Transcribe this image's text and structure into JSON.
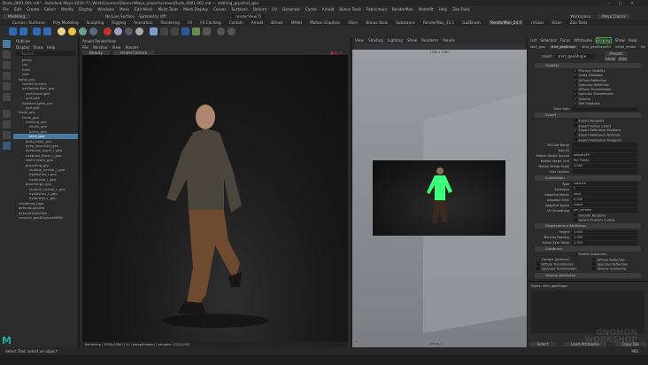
{
  "window": {
    "title": "Dude_0001.001.mb* - Autodesk Maya 2020: F:\\_Work\\Gnomon\\Dancer\\Maya_project\\scenes\\Dude_0001.001.mb  ---  clothing_grp|shirt_geo",
    "workspace_label": "Workspace :",
    "workspace": "Maya Classic"
  },
  "menu": [
    "File",
    "Edit",
    "Create",
    "Select",
    "Modify",
    "Display",
    "Windows",
    "Mesh",
    "Edit Mesh",
    "Mesh Tools",
    "Mesh Display",
    "Curves",
    "Surfaces",
    "Deform",
    "UV",
    "Generate",
    "Cache",
    "Arnold",
    "Bonus Tools",
    "Fabricmani",
    "RenderMan",
    "Redshift",
    "Help",
    "Zoo Tools"
  ],
  "status": {
    "mode": "Modeling",
    "no_live": "No Live Surface",
    "symmetry": "Symmetry: Off",
    "camera": "renderView75"
  },
  "shelf_tabs": [
    "Curves / Surfaces",
    "Poly Modeling",
    "Sculpting",
    "Rigging",
    "Animation",
    "Rendering",
    "FX",
    "FX Caching",
    "Custom",
    "Arnold",
    "Bifrost",
    "MASH",
    "Motion Graphics",
    "XGen",
    "Bonus Tools",
    "Substance",
    "RenderMan_22.1",
    "GoZBrush",
    "RenderMan_24.0",
    "mGear",
    "XGen",
    "Zoo Tools"
  ],
  "shelf_active": "RenderMan_24.0",
  "outliner": {
    "title": "Outliner",
    "menu": [
      "Display",
      "Show",
      "Help"
    ],
    "search": "Search...",
    "items": [
      "persp",
      "top",
      "front",
      "side",
      "lights_grp",
      "renderCamera",
      "pxrRenderMan_grp",
      "pxrDomeLight",
      "pxrLight",
      "lookdevLights_grp",
      "pxrLight",
      "Dude_grp",
      "Dude_geo",
      "clothing_grp",
      "shoes_geo",
      "pants_geo",
      "shirt_geo",
      "body_body_geo",
      "eyes_lowerEye_geo",
      "eyebrow_upper_l_geo",
      "eyebrow_lower_l_geo",
      "teeth_teeth_geo",
      "grooming_grp",
      "stubble_neckal_l_geo",
      "eyelashes_l_geo",
      "eyebrows_l_geo",
      "grooming2_grp",
      "stubble_neckal_r_geo",
      "eyelashes_r_geo",
      "eyebrows_r_geo",
      "rendering_tags",
      "defaultLightSet",
      "defaultObjectSet",
      "rmanvtl_geoDisplaceNMW"
    ],
    "selected": "shirt_geo"
  },
  "render_view": {
    "title": "Arnold RenderView",
    "menu": [
      "File",
      "Window",
      "View",
      "Render"
    ],
    "mode": "Beauty",
    "camera": "renderCamera",
    "footer": "Rendering | 1920x1080 (1.0) | persp(Imager) | samples: 4/2/2/2/4/2"
  },
  "viewport": {
    "menu": [
      "View",
      "Shading",
      "Lighting",
      "Show",
      "Renderer",
      "Panels"
    ],
    "resolution": "1920 x 1080",
    "camera": "persp_1"
  },
  "attr": {
    "menu": [
      "List",
      "Selected",
      "Focus",
      "Attributes",
      "Display",
      "Show",
      "Help"
    ],
    "tabs": [
      "shirt_geo",
      "shirt_geoShape",
      "shirt_geoShapeSG",
      "initial_render",
      "Ilm"
    ],
    "label": "mesh:",
    "value": "shirt_geoShape",
    "focus": "Focus",
    "presets": "Presets",
    "show": "Show",
    "hide": "Hide",
    "visibility": {
      "title": "Visibility",
      "items": [
        "Primary Visibility",
        "Casts Shadows",
        "Diffuse Reflection",
        "Specular Reflection",
        "Diffuse Transmission",
        "Specular Transmission",
        "Volume",
        "Self Shadows"
      ],
      "trace_sets": "Trace Sets"
    },
    "export": {
      "title": "Export",
      "items": [
        {
          "label": "Export Tangents",
          "on": false
        },
        {
          "label": "Export Vertex Colors",
          "on": false
        },
        {
          "label": "Export Reference Positions",
          "on": true
        },
        {
          "label": "Export Reference Normals",
          "on": false
        },
        {
          "label": "Export Reference Tangents",
          "on": false
        }
      ],
      "fields": [
        {
          "label": "SSS Set Name",
          "value": ""
        },
        {
          "label": "Toon ID",
          "value": ""
        },
        {
          "label": "Motion Vector Source",
          "value": "velocityPV"
        },
        {
          "label": "Motion Vector Unit",
          "value": "Per Frame"
        },
        {
          "label": "Motion Vector Scale",
          "value": "1.000"
        },
        {
          "label": "User Options",
          "value": ""
        }
      ]
    },
    "subdivision": {
      "title": "Subdivision",
      "fields": [
        {
          "label": "Type",
          "value": "catclark"
        },
        {
          "label": "Iterations",
          "value": "2"
        },
        {
          "label": "Adaptive Metric",
          "value": "auto"
        },
        {
          "label": "Adaptive Error",
          "value": "0.000"
        },
        {
          "label": "Adaptive Space",
          "value": "raster"
        },
        {
          "label": "UV Smoothing",
          "value": "pin_corners"
        }
      ],
      "checks": [
        "Smooth Tangents",
        "Ignore Frustum Culling"
      ]
    },
    "displacement": {
      "title": "Displacement Attributes",
      "fields": [
        {
          "label": "Height",
          "value": "1.000"
        },
        {
          "label": "Bounds Padding",
          "value": "1.000"
        },
        {
          "label": "Scalar Zero Value",
          "value": "1.000"
        }
      ]
    },
    "autobump": {
      "title": "Autobump",
      "enable": "Enable Autobump",
      "items": [
        {
          "label": "Camera (primary)",
          "on": true
        },
        {
          "label": "Diffuse Reflection",
          "on": false
        },
        {
          "label": "Diffuse Transmission",
          "on": false
        },
        {
          "label": "Specular Reflection",
          "on": false
        },
        {
          "label": "Specular Transmission",
          "on": false
        },
        {
          "label": "Volume Scattering",
          "on": false
        }
      ]
    },
    "next_section": "Volume Attributes",
    "notes": "Notes:  shirt_geoShape",
    "buttons": [
      "Select",
      "Load Attributes",
      "Copy Tab"
    ]
  },
  "help_line": "Select Tool: select an object",
  "mel": "MEL",
  "watermark": "GNOMON WORKSHOP",
  "colors": {
    "accent": "#4a7aa0",
    "highlight_green": "#3cff7a",
    "maya_logo": "#1ab1a0"
  }
}
